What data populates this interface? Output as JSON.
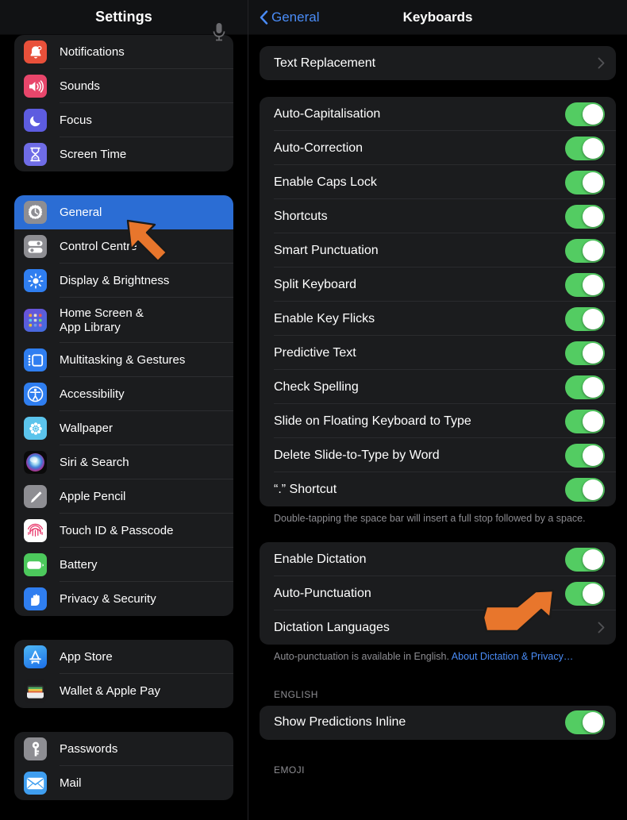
{
  "sidebar": {
    "title": "Settings",
    "mic_icon": "microphone-icon",
    "groups": [
      {
        "items": [
          {
            "label": "Notifications",
            "icon": "notifications-icon"
          },
          {
            "label": "Sounds",
            "icon": "sounds-icon"
          },
          {
            "label": "Focus",
            "icon": "focus-icon"
          },
          {
            "label": "Screen Time",
            "icon": "screen-time-icon"
          }
        ]
      },
      {
        "items": [
          {
            "label": "General",
            "icon": "general-gear-icon",
            "selected": true
          },
          {
            "label": "Control Centre",
            "icon": "control-centre-icon"
          },
          {
            "label": "Display & Brightness",
            "icon": "display-brightness-icon"
          },
          {
            "label": "Home Screen &\nApp Library",
            "icon": "home-screen-icon",
            "tall": true
          },
          {
            "label": "Multitasking & Gestures",
            "icon": "multitasking-icon"
          },
          {
            "label": "Accessibility",
            "icon": "accessibility-icon"
          },
          {
            "label": "Wallpaper",
            "icon": "wallpaper-icon"
          },
          {
            "label": "Siri & Search",
            "icon": "siri-icon"
          },
          {
            "label": "Apple Pencil",
            "icon": "apple-pencil-icon"
          },
          {
            "label": "Touch ID & Passcode",
            "icon": "touch-id-icon"
          },
          {
            "label": "Battery",
            "icon": "battery-icon"
          },
          {
            "label": "Privacy & Security",
            "icon": "privacy-security-icon"
          }
        ]
      },
      {
        "items": [
          {
            "label": "App Store",
            "icon": "app-store-icon"
          },
          {
            "label": "Wallet & Apple Pay",
            "icon": "wallet-icon"
          }
        ]
      },
      {
        "items": [
          {
            "label": "Passwords",
            "icon": "passwords-icon"
          },
          {
            "label": "Mail",
            "icon": "mail-icon"
          }
        ]
      }
    ]
  },
  "detail": {
    "back_label": "General",
    "title": "Keyboards",
    "sections": [
      {
        "rows": [
          {
            "label": "Text Replacement",
            "type": "disclosure"
          }
        ]
      },
      {
        "rows": [
          {
            "label": "Auto-Capitalisation",
            "type": "toggle",
            "on": true
          },
          {
            "label": "Auto-Correction",
            "type": "toggle",
            "on": true
          },
          {
            "label": "Enable Caps Lock",
            "type": "toggle",
            "on": true
          },
          {
            "label": "Shortcuts",
            "type": "toggle",
            "on": true
          },
          {
            "label": "Smart Punctuation",
            "type": "toggle",
            "on": true
          },
          {
            "label": "Split Keyboard",
            "type": "toggle",
            "on": true
          },
          {
            "label": "Enable Key Flicks",
            "type": "toggle",
            "on": true
          },
          {
            "label": "Predictive Text",
            "type": "toggle",
            "on": true
          },
          {
            "label": "Check Spelling",
            "type": "toggle",
            "on": true
          },
          {
            "label": "Slide on Floating Keyboard to Type",
            "type": "toggle",
            "on": true
          },
          {
            "label": "Delete Slide-to-Type by Word",
            "type": "toggle",
            "on": true
          },
          {
            "label": "“.” Shortcut",
            "type": "toggle",
            "on": true
          }
        ],
        "footnote": "Double-tapping the space bar will insert a full stop followed by a space."
      },
      {
        "rows": [
          {
            "label": "Enable Dictation",
            "type": "toggle",
            "on": true
          },
          {
            "label": "Auto-Punctuation",
            "type": "toggle",
            "on": true
          },
          {
            "label": "Dictation Languages",
            "type": "disclosure"
          }
        ],
        "footnote": "Auto-punctuation is available in English.",
        "footnote_link": "About Dictation & Privacy…"
      },
      {
        "header": "ENGLISH",
        "rows": [
          {
            "label": "Show Predictions Inline",
            "type": "toggle",
            "on": true
          }
        ]
      },
      {
        "header": "EMOJI",
        "rows": []
      }
    ]
  },
  "annotations": {
    "arrow_color": "#e8762c",
    "arrows": [
      {
        "name": "arrow-pointing-to-general",
        "target": "General"
      },
      {
        "name": "arrow-pointing-to-enable-dictation-toggle",
        "target": "Enable Dictation"
      }
    ]
  },
  "colors": {
    "selection_blue": "#2b6dd4",
    "toggle_green": "#53cc62",
    "link_blue": "#4a8cf7",
    "card": "#1b1c1e",
    "background": "#000000"
  }
}
